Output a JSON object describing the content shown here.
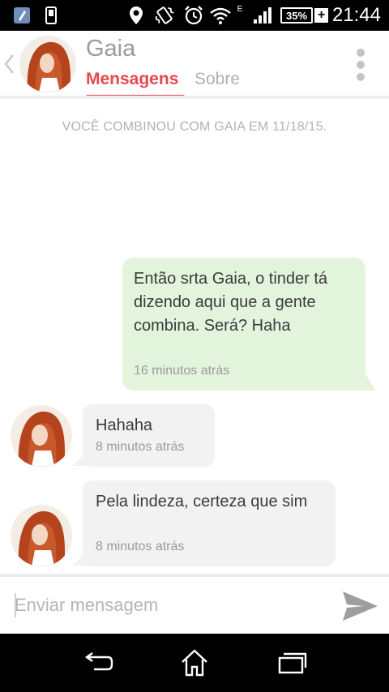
{
  "status_bar": {
    "time": "21:44",
    "battery": "35%",
    "battery_plus": "+",
    "network_type": "E",
    "icons": [
      "app-notification-icon",
      "phone-notification-icon",
      "location-icon",
      "vibrate-icon",
      "alarm-icon",
      "wifi-icon",
      "signal-icon",
      "battery-icon"
    ]
  },
  "header": {
    "contact_name": "Gaia",
    "tabs": [
      {
        "label": "Mensagens",
        "active": true
      },
      {
        "label": "Sobre",
        "active": false
      }
    ],
    "accent_color": "#e8474f"
  },
  "match_notice": "VOCÊ COMBINOU COM GAIA EM 11/18/15.",
  "messages": [
    {
      "direction": "outgoing",
      "text": "Então srta Gaia, o tinder tá dizendo aqui que a gente combina. Será? Haha",
      "time": "16 minutos atrás",
      "bubble_color": "#e3f4dd"
    },
    {
      "direction": "incoming",
      "text": "Hahaha",
      "time": "8 minutos atrás",
      "bubble_color": "#f2f2f2"
    },
    {
      "direction": "incoming",
      "text": "Pela lindeza, certeza que sim",
      "time": "8 minutos atrás",
      "bubble_color": "#f2f2f2"
    }
  ],
  "composer": {
    "placeholder": "Enviar mensagem",
    "value": ""
  },
  "nav_bar": {
    "buttons": [
      "back-icon",
      "home-icon",
      "recent-apps-icon"
    ]
  }
}
